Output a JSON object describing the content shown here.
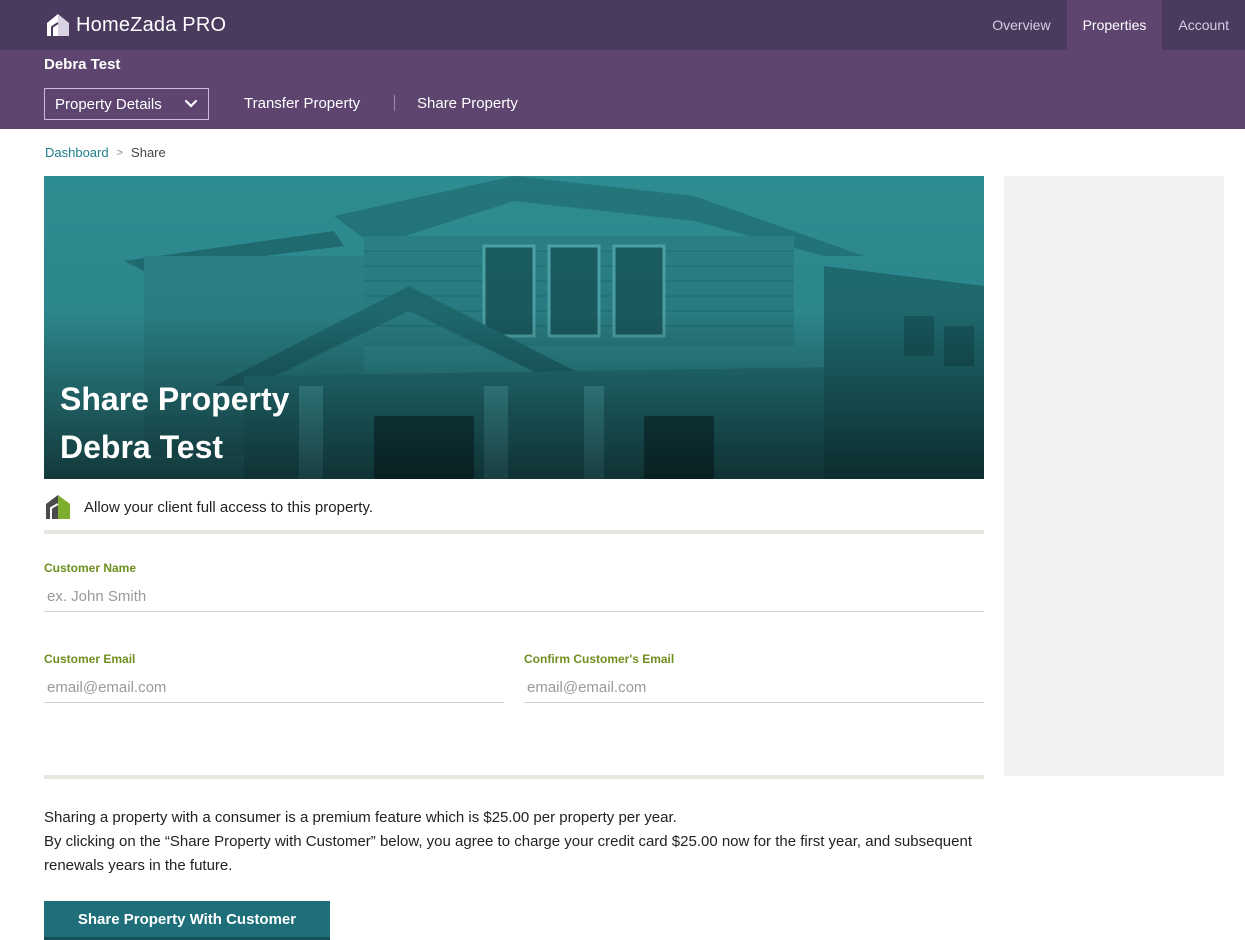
{
  "app": {
    "logo_text": "HomeZada PRO"
  },
  "topnav": {
    "items": [
      {
        "label": "Overview",
        "active": false
      },
      {
        "label": "Properties",
        "active": true
      },
      {
        "label": "Account",
        "active": false
      }
    ]
  },
  "subheader": {
    "property_name": "Debra Test",
    "dropdown_label": "Property Details",
    "links": [
      "Transfer Property",
      "Share Property"
    ]
  },
  "breadcrumb": {
    "root": "Dashboard",
    "separator": ">",
    "current": "Share"
  },
  "hero": {
    "title": "Share Property",
    "subtitle": "Debra Test"
  },
  "info": {
    "text": "Allow your client full access to this property."
  },
  "form": {
    "customer_name": {
      "label": "Customer Name",
      "placeholder": "ex. John Smith",
      "value": ""
    },
    "customer_email": {
      "label": "Customer Email",
      "placeholder": "email@email.com",
      "value": ""
    },
    "confirm_email": {
      "label": "Confirm Customer's Email",
      "placeholder": "email@email.com",
      "value": ""
    }
  },
  "terms": {
    "line1": "Sharing a property with a consumer is a premium feature which is $25.00 per property per year.",
    "line2": "By clicking on the “Share Property with Customer” below, you agree to charge your credit card $25.00 now for the first year, and subsequent renewals years in the future."
  },
  "actions": {
    "share_label": "Share Property With Customer"
  },
  "colors": {
    "topbar": "#4a3a5e",
    "subbar": "#5e4570",
    "accent_teal": "#1e6f7a",
    "label_green": "#6f8f1f",
    "link_teal": "#1f7f8a"
  },
  "icons": {
    "logo": "house-logo-icon",
    "dropdown": "chevron-down-icon",
    "info": "house-logo-icon"
  }
}
